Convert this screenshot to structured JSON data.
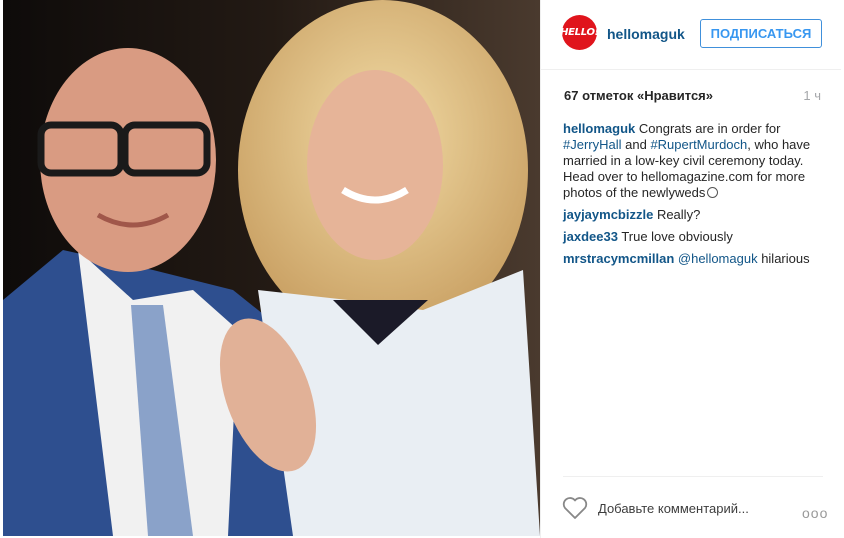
{
  "post": {
    "image_alt": "Rupert Murdoch and Jerry Hall",
    "image_icon": "photo"
  },
  "header": {
    "logo_text": "HELLO!",
    "username": "hellomaguk",
    "follow_label": "ПОДПИСАТЬСЯ"
  },
  "meta": {
    "likes": "67 отметок «Нравится»",
    "time": "1 ч"
  },
  "comments": [
    {
      "user": "hellomaguk",
      "parts": [
        {
          "type": "text",
          "value": " Congrats are in order for "
        },
        {
          "type": "tag",
          "value": "#JerryHall"
        },
        {
          "type": "text",
          "value": " and "
        },
        {
          "type": "tag",
          "value": "#RupertMurdoch"
        },
        {
          "type": "text",
          "value": ", who have married in a low-key civil ceremony today. Head over to hellomagazine.com for more photos of the newlyweds"
        }
      ],
      "emoji": "smiling-face"
    },
    {
      "user": "jayjaymcbizzle",
      "text": " Really?"
    },
    {
      "user": "jaxdee33",
      "text": " True love obviously"
    },
    {
      "user": "mrstracymcmillan",
      "mention": " @hellomaguk",
      "text": " hilarious"
    }
  ],
  "footer": {
    "comment_placeholder": "Добавьте комментарий...",
    "more_label": "ooo",
    "like_icon": "heart-outline"
  },
  "colors": {
    "link": "#125688",
    "follow": "#3897f0",
    "logo": "#e0141c"
  }
}
